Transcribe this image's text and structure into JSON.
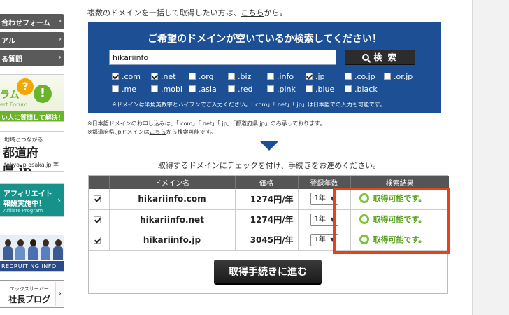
{
  "sidebar": {
    "links": [
      {
        "label": "合わせフォーム"
      },
      {
        "label": "アル"
      },
      {
        "label": "る質問"
      }
    ],
    "forum_banner": {
      "title": "ラム",
      "subtitle": "ert Forum",
      "bar_text": "い人に質問して解決！",
      "q1": "?",
      "q2": "!"
    },
    "todofuken_banner": {
      "small": "地域とつながる",
      "big": "都道府県.jp",
      "sub": "tokyo.jp osaka.jp 等"
    },
    "affiliate_banner": {
      "line1": "アフィリエイト",
      "line2": "報酬実施中！",
      "line3": "Afiliate Program"
    },
    "recruit_banner": {
      "label": "RECRUITING INFO"
    },
    "blog_banner": {
      "line1": "エックスサーバー",
      "line2": "社長ブログ"
    }
  },
  "intro": {
    "before": "複数のドメインを一括して取得したい方は、",
    "link": "こちら",
    "after": "から。"
  },
  "search": {
    "title": "ご希望のドメインが空いているか検索してください！",
    "input_value": "hikariinfo",
    "button_label": "検 索",
    "tlds_row1": [
      {
        "label": ".com",
        "checked": true
      },
      {
        "label": ".net",
        "checked": true
      },
      {
        "label": ".org",
        "checked": false
      },
      {
        "label": ".biz",
        "checked": false
      },
      {
        "label": ".info",
        "checked": false
      },
      {
        "label": ".jp",
        "checked": true
      },
      {
        "label": ".co.jp",
        "checked": false
      },
      {
        "label": ".or.jp",
        "checked": false
      }
    ],
    "tlds_row2": [
      {
        "label": ".me",
        "checked": false
      },
      {
        "label": ".mobi",
        "checked": false
      },
      {
        "label": ".asia",
        "checked": false
      },
      {
        "label": ".red",
        "checked": false
      },
      {
        "label": ".pink",
        "checked": false
      },
      {
        "label": ".blue",
        "checked": false
      },
      {
        "label": ".black",
        "checked": false
      }
    ],
    "note": "※ドメインは半角英数字とハイフンでご入力ください。「.com」「.net」「.jp」は日本語での入力も可能です。"
  },
  "notes": {
    "line1": "※日本語ドメインのお申し込みは、「.com」「.net」「.jp」「都道府県.jp」のみ承っております。",
    "line2_before": "※都道府県.jpドメインは",
    "line2_link": "こちら",
    "line2_after": "から検索可能です。"
  },
  "instruction": "取得するドメインにチェックを付け、手続きをお進めください。",
  "results": {
    "headers": [
      "",
      "ドメイン名",
      "価格",
      "登録年数",
      "検索結果"
    ],
    "rows": [
      {
        "domain": "hikariinfo.com",
        "price": "1274円/年",
        "years": "1年",
        "status": "取得可能です。",
        "checked": true
      },
      {
        "domain": "hikariinfo.net",
        "price": "1274円/年",
        "years": "1年",
        "status": "取得可能です。",
        "checked": true
      },
      {
        "domain": "hikariinfo.jp",
        "price": "3045円/年",
        "years": "1年",
        "status": "取得可能です。",
        "checked": true
      }
    ]
  },
  "proceed_button": "取得手続きに進む",
  "colors": {
    "panel_blue": "#1c4f93",
    "available_green": "#54a018",
    "highlight_red": "#e8421a",
    "affiliate_teal": "#17928a"
  }
}
